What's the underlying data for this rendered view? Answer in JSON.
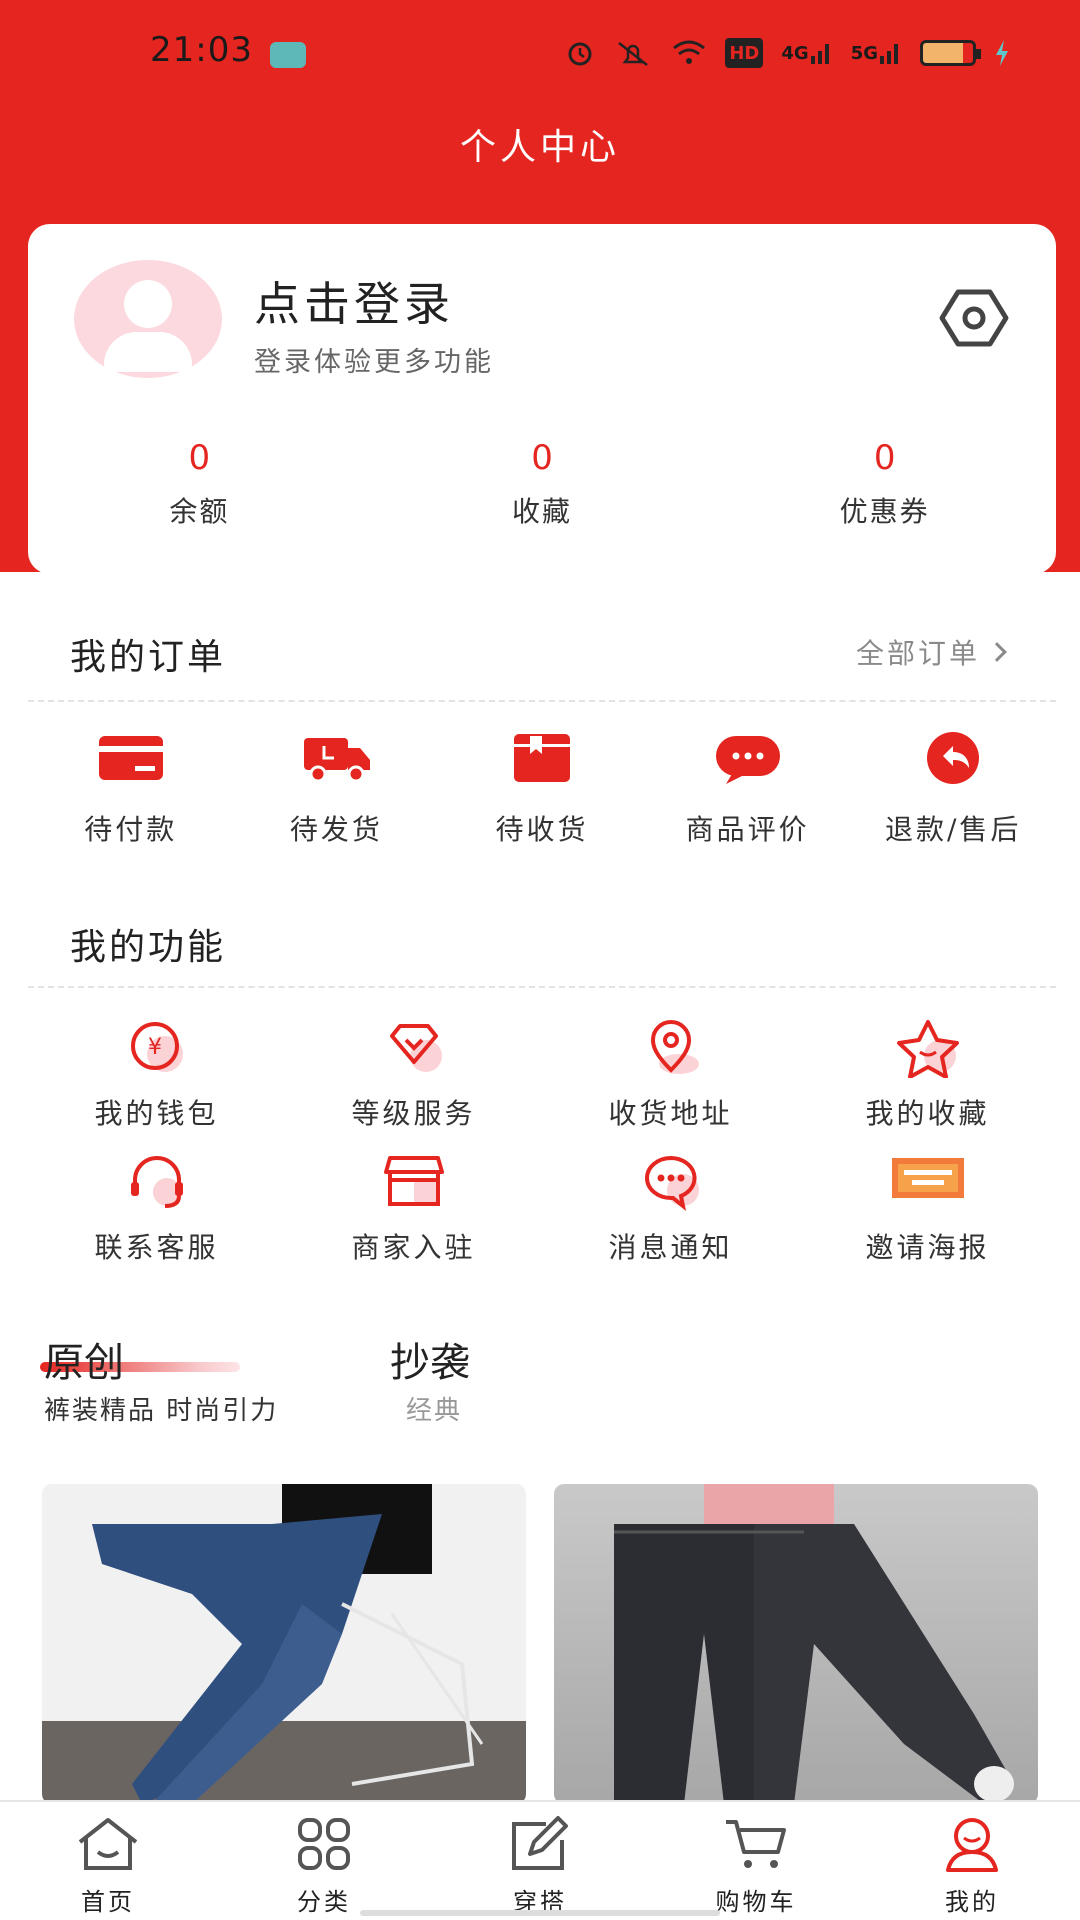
{
  "status_bar": {
    "time": "21:03",
    "net1": "HD",
    "net2": "4G",
    "net3": "5G"
  },
  "header": {
    "title": "个人中心"
  },
  "profile": {
    "login_title": "点击登录",
    "login_subtitle": "登录体验更多功能",
    "stats": [
      {
        "value": "0",
        "label": "余额"
      },
      {
        "value": "0",
        "label": "收藏"
      },
      {
        "value": "0",
        "label": "优惠券"
      }
    ]
  },
  "orders": {
    "title": "我的订单",
    "all_orders": "全部订单",
    "items": [
      {
        "label": "待付款",
        "icon": "card-icon"
      },
      {
        "label": "待发货",
        "icon": "truck-icon"
      },
      {
        "label": "待收货",
        "icon": "package-icon"
      },
      {
        "label": "商品评价",
        "icon": "comment-icon"
      },
      {
        "label": "退款/售后",
        "icon": "return-icon"
      }
    ]
  },
  "functions": {
    "title": "我的功能",
    "items": [
      {
        "label": "我的钱包",
        "icon": "wallet-icon"
      },
      {
        "label": "等级服务",
        "icon": "diamond-icon"
      },
      {
        "label": "收货地址",
        "icon": "location-icon"
      },
      {
        "label": "我的收藏",
        "icon": "star-icon"
      },
      {
        "label": "联系客服",
        "icon": "headset-icon"
      },
      {
        "label": "商家入驻",
        "icon": "store-icon"
      },
      {
        "label": "消息通知",
        "icon": "message-icon"
      },
      {
        "label": "邀请海报",
        "icon": "poster-icon"
      }
    ]
  },
  "tabs": {
    "tab1_title": "原创",
    "tab1_subtitle": "裤装精品 时尚引力",
    "tab2_title": "抄袭",
    "tab2_subtitle": "经典"
  },
  "bottom_nav": [
    {
      "label": "首页",
      "icon": "home-icon"
    },
    {
      "label": "分类",
      "icon": "grid-icon"
    },
    {
      "label": "穿搭",
      "icon": "edit-icon"
    },
    {
      "label": "购物车",
      "icon": "cart-icon"
    },
    {
      "label": "我的",
      "icon": "profile-icon"
    }
  ],
  "colors": {
    "accent": "#e5251f",
    "avatar_bg": "#fbd9de",
    "muted": "#8a8a8a"
  }
}
